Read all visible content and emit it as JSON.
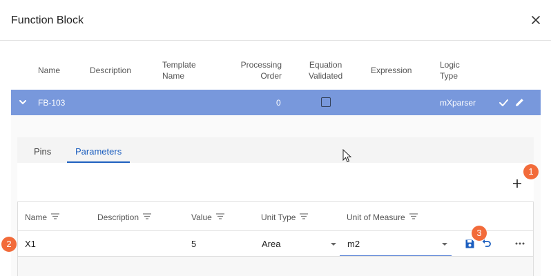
{
  "dialog": {
    "title": "Function Block"
  },
  "grid": {
    "headers": {
      "name": "Name",
      "description": "Description",
      "template_name_1": "Template",
      "template_name_2": "Name",
      "processing_order_1": "Processing",
      "processing_order_2": "Order",
      "equation_validated_1": "Equation",
      "equation_validated_2": "Validated",
      "expression": "Expression",
      "logic_type_1": "Logic",
      "logic_type_2": "Type"
    },
    "row": {
      "name": "FB-103",
      "processing_order": "0",
      "equation_validated": false,
      "logic_type": "mXparser"
    }
  },
  "detail": {
    "tabs": [
      {
        "label": "Pins"
      },
      {
        "label": "Parameters",
        "active": true
      }
    ],
    "parameters": {
      "headers": {
        "name": "Name",
        "description": "Description",
        "value": "Value",
        "unit_type": "Unit Type",
        "unit_of_measure": "Unit of Measure"
      },
      "row": {
        "name": "X1",
        "description": "",
        "value": "5",
        "unit_type": "Area",
        "unit_of_measure": "m2"
      }
    }
  },
  "annotations": {
    "badge1": "1",
    "badge2": "2",
    "badge3": "3"
  },
  "colors": {
    "selected_row": "#7898dc",
    "accent": "#1d5fbf",
    "badge": "#f26b3a"
  },
  "icons": [
    "close-icon",
    "chevron-down-icon",
    "checkmark-icon",
    "pencil-icon",
    "plus-icon",
    "filter-icon",
    "dropdown-arrow-icon",
    "save-icon",
    "undo-icon",
    "more-icon",
    "mouse-cursor-icon"
  ]
}
